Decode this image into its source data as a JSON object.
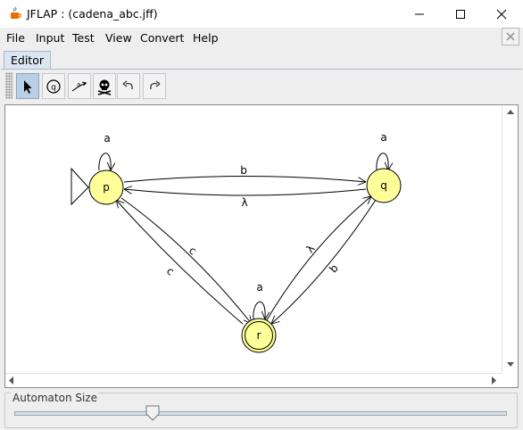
{
  "window": {
    "title": "JFLAP : (cadena_abc.jff)"
  },
  "menu": [
    "File",
    "Input",
    "Test",
    "View",
    "Convert",
    "Help"
  ],
  "tabs": [
    {
      "label": "Editor",
      "selected": true
    }
  ],
  "toolbar": {
    "tools": [
      {
        "icon": "attribute-editor-arrow-icon",
        "selected": true
      },
      {
        "icon": "state-creator-icon",
        "selected": false
      },
      {
        "icon": "transition-creator-icon",
        "selected": false
      },
      {
        "icon": "deleter-skull-icon",
        "selected": false
      },
      {
        "icon": "undo-icon",
        "selected": false
      },
      {
        "icon": "redo-icon",
        "selected": false
      }
    ]
  },
  "automaton": {
    "states": [
      {
        "name": "p",
        "initial": true,
        "final": false
      },
      {
        "name": "q",
        "initial": false,
        "final": false
      },
      {
        "name": "r",
        "initial": false,
        "final": true
      }
    ],
    "transitions": [
      {
        "from": "p",
        "to": "p",
        "label": "a"
      },
      {
        "from": "q",
        "to": "q",
        "label": "a"
      },
      {
        "from": "r",
        "to": "r",
        "label": "a"
      },
      {
        "from": "p",
        "to": "q",
        "label": "b"
      },
      {
        "from": "q",
        "to": "p",
        "label": "λ"
      },
      {
        "from": "p",
        "to": "r",
        "label": "c"
      },
      {
        "from": "r",
        "to": "p",
        "label": "c"
      },
      {
        "from": "r",
        "to": "q",
        "label": "λ"
      },
      {
        "from": "q",
        "to": "r",
        "label": "b"
      }
    ],
    "state_fill": "#ffff99"
  },
  "size_panel": {
    "label": "Automaton Size",
    "value_fraction": 0.28
  }
}
